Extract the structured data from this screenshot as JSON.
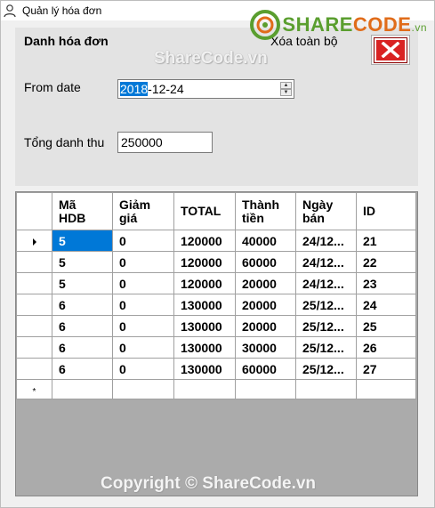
{
  "window": {
    "title": "Quản lý hóa đơn"
  },
  "watermarks": {
    "logo_share": "SHARE",
    "logo_code": "CODE",
    "logo_vn": ".vn",
    "middle": "ShareCode.vn",
    "bottom": "Copyright © ShareCode.vn"
  },
  "form": {
    "heading": "Danh hóa đơn",
    "clear_all_label": "Xóa toàn bộ",
    "from_date_label": "From date",
    "from_date_year": "2018",
    "from_date_rest": "-12-24",
    "total_label": "Tổng danh thu",
    "total_value": "250000"
  },
  "grid": {
    "headers": [
      [
        "Mã",
        "HDB"
      ],
      [
        "Giảm",
        "giá"
      ],
      [
        "TOTAL"
      ],
      [
        "Thành",
        "tiền"
      ],
      [
        "Ngày",
        "bán"
      ],
      [
        "ID"
      ]
    ],
    "rows": [
      [
        "5",
        "0",
        "120000",
        "40000",
        "24/12...",
        "21"
      ],
      [
        "5",
        "0",
        "120000",
        "60000",
        "24/12...",
        "22"
      ],
      [
        "5",
        "0",
        "120000",
        "20000",
        "24/12...",
        "23"
      ],
      [
        "6",
        "0",
        "130000",
        "20000",
        "25/12...",
        "24"
      ],
      [
        "6",
        "0",
        "130000",
        "20000",
        "25/12...",
        "25"
      ],
      [
        "6",
        "0",
        "130000",
        "30000",
        "25/12...",
        "26"
      ],
      [
        "6",
        "0",
        "130000",
        "60000",
        "25/12...",
        "27"
      ]
    ],
    "new_row_marker": "*"
  },
  "colors": {
    "selection": "#0078d7",
    "delete_button": "#d92323",
    "logo_green": "#5a9e2f",
    "logo_orange": "#e06c1a"
  },
  "icons": [
    "user-icon",
    "logo-icon",
    "close-x-icon",
    "row-pointer-icon",
    "spin-up-icon",
    "spin-down-icon"
  ]
}
